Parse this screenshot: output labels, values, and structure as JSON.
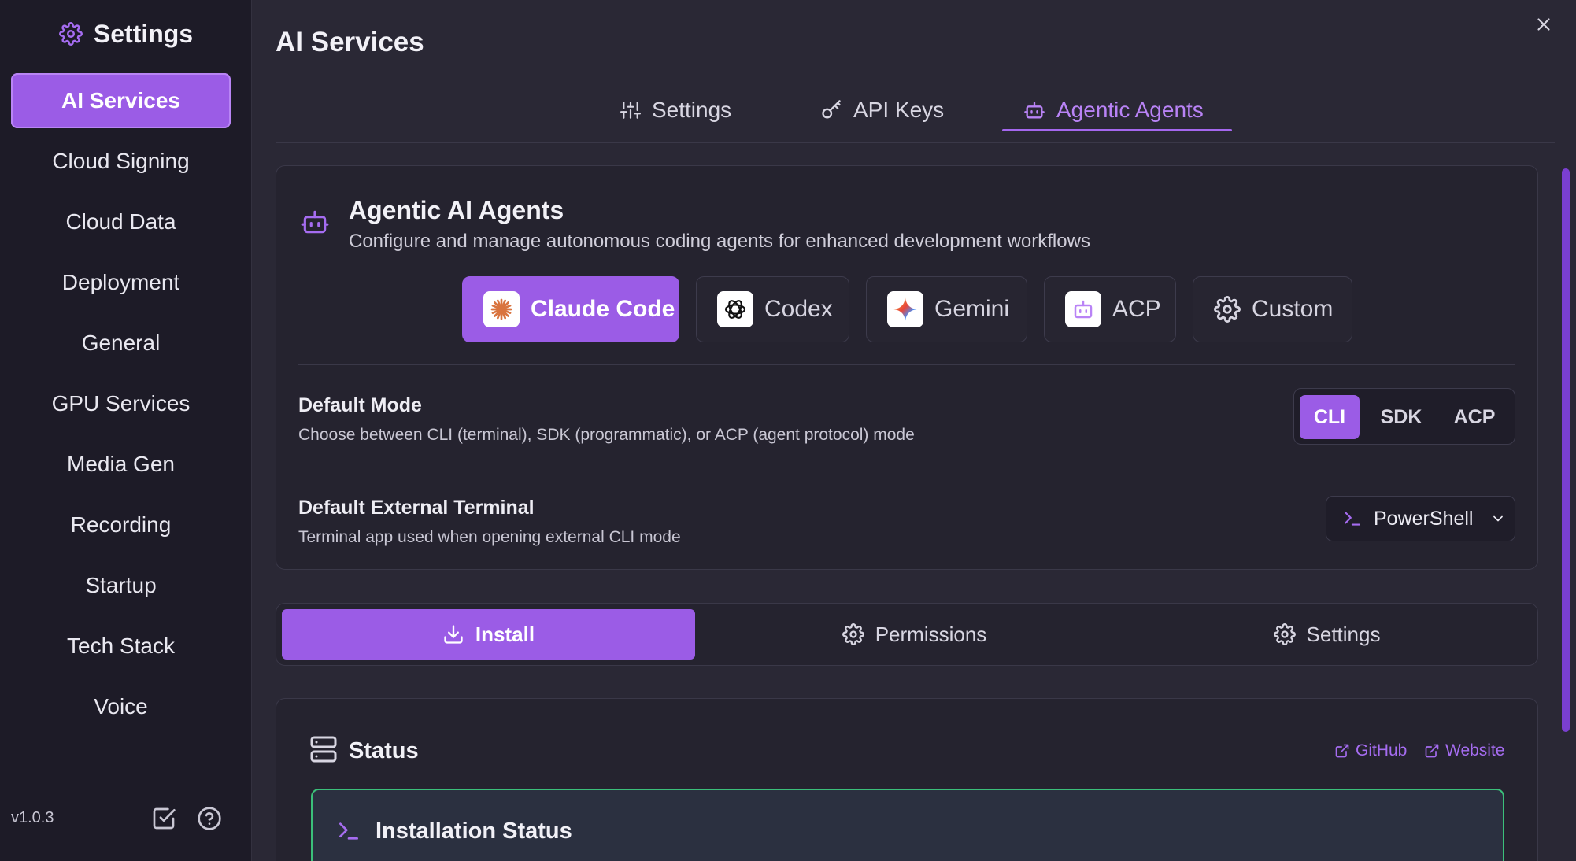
{
  "sidebar": {
    "title": "Settings",
    "items": [
      {
        "label": "AI Services",
        "active": true
      },
      {
        "label": "Cloud Signing"
      },
      {
        "label": "Cloud Data"
      },
      {
        "label": "Deployment"
      },
      {
        "label": "General"
      },
      {
        "label": "GPU Services"
      },
      {
        "label": "Media Gen"
      },
      {
        "label": "Recording"
      },
      {
        "label": "Startup"
      },
      {
        "label": "Tech Stack"
      },
      {
        "label": "Voice"
      }
    ],
    "version": "v1.0.3"
  },
  "main": {
    "title": "AI Services",
    "tabs": [
      {
        "label": "Settings",
        "icon": "sliders-icon"
      },
      {
        "label": "API Keys",
        "icon": "key-icon"
      },
      {
        "label": "Agentic Agents",
        "icon": "bot-icon",
        "active": true
      }
    ]
  },
  "agents": {
    "title": "Agentic AI Agents",
    "subtitle": "Configure and manage autonomous coding agents for enhanced development workflows",
    "options": [
      {
        "label": "Claude Code",
        "icon": "claude-logo-icon",
        "active": true
      },
      {
        "label": "Codex",
        "icon": "openai-logo-icon"
      },
      {
        "label": "Gemini",
        "icon": "gemini-logo-icon"
      },
      {
        "label": "ACP",
        "icon": "bot-icon"
      },
      {
        "label": "Custom",
        "icon": "gear-icon"
      }
    ],
    "default_mode": {
      "title": "Default Mode",
      "description": "Choose between CLI (terminal), SDK (programmatic), or ACP (agent protocol) mode",
      "options": [
        "CLI",
        "SDK",
        "ACP"
      ],
      "selected": "CLI"
    },
    "default_terminal": {
      "title": "Default External Terminal",
      "description": "Terminal app used when opening external CLI mode",
      "value": "PowerShell"
    }
  },
  "subtabs": [
    {
      "label": "Install",
      "icon": "download-icon",
      "active": true
    },
    {
      "label": "Permissions",
      "icon": "gear-icon"
    },
    {
      "label": "Settings",
      "icon": "gear-icon"
    }
  ],
  "status": {
    "title": "Status",
    "links": [
      {
        "label": "GitHub"
      },
      {
        "label": "Website"
      }
    ],
    "install_box_title": "Installation Status"
  },
  "colors": {
    "accent": "#9b5ce6",
    "success_border": "#3bbf7a",
    "background": "#2a2835",
    "sidebar": "#1d1b27"
  }
}
